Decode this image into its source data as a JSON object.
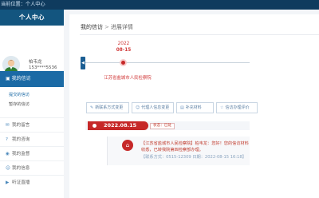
{
  "topbar": {
    "location": "当前位置：个人中心"
  },
  "sidebar": {
    "title": "个人中心",
    "user": {
      "name": "柏韦龙",
      "phone": "153****5536"
    },
    "active_item": "我的信访",
    "sub_items": [
      {
        "label": "提交的信访",
        "active": true
      },
      {
        "label": "暂存的信访",
        "active": false
      }
    ],
    "items": [
      {
        "label": "我的留言",
        "icon": "message-icon"
      },
      {
        "label": "我的咨询",
        "icon": "question-icon"
      },
      {
        "label": "我的监督",
        "icon": "eye-icon"
      },
      {
        "label": "我的信息",
        "icon": "user-icon"
      },
      {
        "label": "听证直播",
        "icon": "video-icon"
      }
    ]
  },
  "main": {
    "breadcrumb": {
      "root": "我的信访",
      "separator": ">",
      "current": "进展详情"
    },
    "timeline": {
      "year": "2022",
      "date": "08-15",
      "org": "江苏省盐城市人民检察院"
    },
    "actions": [
      {
        "label": "新联系方式变更",
        "icon": "edit-icon"
      },
      {
        "label": "代理人信息变更",
        "icon": "user-icon"
      },
      {
        "label": "补充材料",
        "icon": "file-icon"
      },
      {
        "label": "信访办理评价",
        "icon": "star-icon"
      }
    ],
    "record": {
      "date": "2022.08.15",
      "status": "状态：已处"
    },
    "message": {
      "text": "【江苏省盐城市人民检察院】柏韦龙：您好！您的信访材料收悉，已转我院第四检察部办理。",
      "contact": "【联系方式：0515-12309 日期：2022-08-15 16:18】"
    }
  },
  "colors": {
    "primary": "#13557f",
    "accent": "#1b6aa5",
    "alert": "#c62828"
  }
}
